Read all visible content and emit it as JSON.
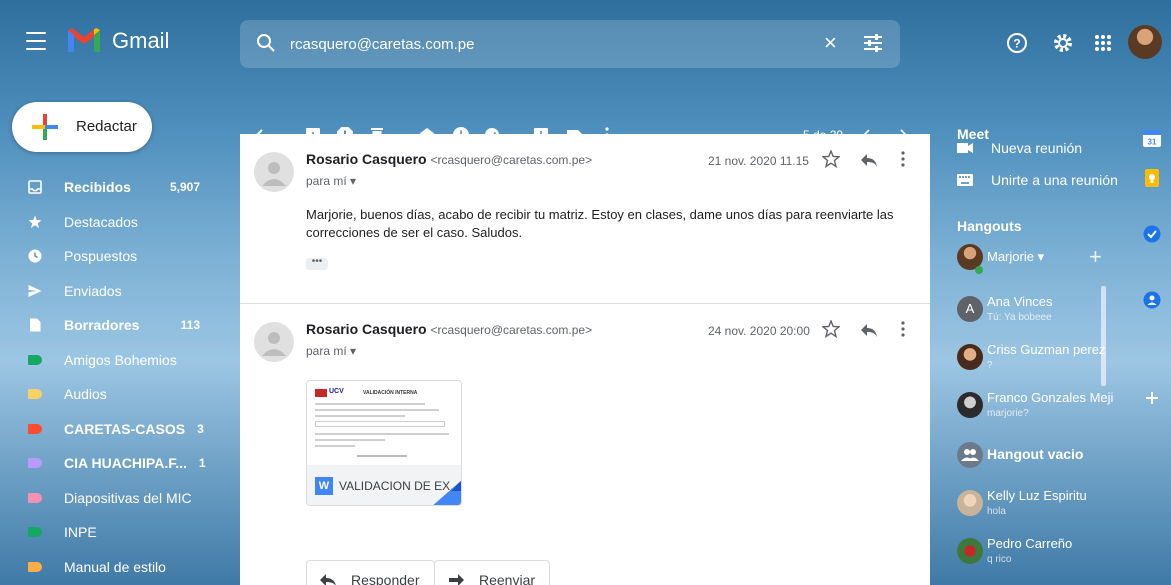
{
  "app": {
    "name": "Gmail"
  },
  "search": {
    "value": "rcasquero@caretas.com.pe",
    "clear_label": "×"
  },
  "compose": {
    "label": "Redactar"
  },
  "nav": {
    "items": [
      {
        "label": "Recibidos",
        "count": "5,907",
        "bold": true,
        "icon": "inbox-icon"
      },
      {
        "label": "Destacados",
        "count": "",
        "bold": false,
        "icon": "star-icon"
      },
      {
        "label": "Pospuestos",
        "count": "",
        "bold": false,
        "icon": "clock-icon"
      },
      {
        "label": "Enviados",
        "count": "",
        "bold": false,
        "icon": "send-icon"
      },
      {
        "label": "Borradores",
        "count": "113",
        "bold": true,
        "icon": "draft-icon"
      }
    ],
    "labels": [
      {
        "label": "Amigos Bohemios",
        "count": "",
        "bold": false,
        "color": "#16a765"
      },
      {
        "label": "Audios",
        "count": "",
        "bold": false,
        "color": "#fad165"
      },
      {
        "label": "CARETAS-CASOS",
        "count": "3",
        "bold": true,
        "color": "#fb4c2f"
      },
      {
        "label": "CIA HUACHIPA.F...",
        "count": "1",
        "bold": true,
        "color": "#b99aff"
      },
      {
        "label": "Diapositivas del MIC",
        "count": "",
        "bold": false,
        "color": "#f691b2"
      },
      {
        "label": "INPE",
        "count": "",
        "bold": false,
        "color": "#16a765"
      },
      {
        "label": "Manual de estilo",
        "count": "",
        "bold": false,
        "color": "#ffad46"
      }
    ]
  },
  "toolbar": {
    "pager": "5 de 29"
  },
  "messages": [
    {
      "sender_name": "Rosario Casquero",
      "sender_email": "<rcasquero@caretas.com.pe>",
      "to": "para mí ▾",
      "date": "21 nov. 2020 11.15",
      "body": "Marjorie, buenos días, acabo de recibir tu matriz. Estoy en clases, dame unos días para reenviarte las correcciones de ser el caso. Saludos.",
      "trimmed": "•••"
    },
    {
      "sender_name": "Rosario Casquero",
      "sender_email": "<rcasquero@caretas.com.pe>",
      "to": "para mí ▾",
      "date": "24 nov. 2020  20:00",
      "attachment": {
        "name": "VALIDACION DE EX...",
        "type_letter": "W",
        "preview_org": "UCV",
        "preview_title": "VALIDACIÓN INTERNA"
      }
    }
  ],
  "actions": {
    "reply": "Responder",
    "forward": "Reenviar"
  },
  "meet": {
    "title": "Meet",
    "new_meeting": "Nueva reunión",
    "join": "Unirte a una reunión"
  },
  "hangouts": {
    "title": "Hangouts",
    "me": "Marjorie ▾",
    "contacts": [
      {
        "name": "Ana Vinces",
        "status": "Tú: Ya bobeee",
        "initial": "A",
        "color": "#5f6368"
      },
      {
        "name": "Criss Guzman perez",
        "status": "?",
        "initial": "",
        "color": "#4a2a1a"
      },
      {
        "name": "Franco Gonzales Meji",
        "status": "marjorie?",
        "initial": "",
        "color": "#2b2b2b"
      },
      {
        "name": "Hangout vacio",
        "status": "",
        "initial": "",
        "color": "#6b7a88"
      },
      {
        "name": "Kelly Luz Espiritu",
        "status": "hola",
        "initial": "",
        "color": "#c9b39a"
      },
      {
        "name": "Pedro Carreño",
        "status": "q rico",
        "initial": "",
        "color": "#3b7a3b"
      }
    ]
  },
  "colors": {
    "accent": "#1a73e8",
    "mail_bg": "#ffffff"
  }
}
